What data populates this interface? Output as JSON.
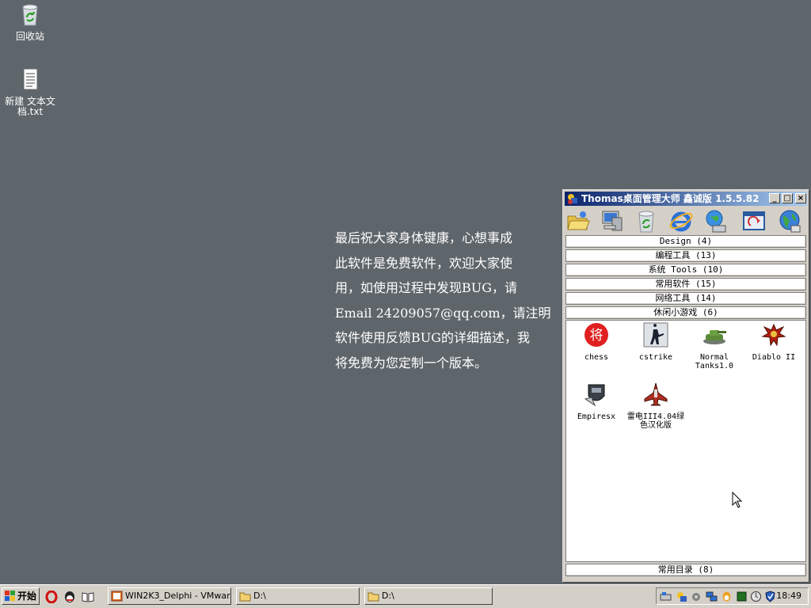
{
  "desktop": {
    "icons": [
      {
        "label": "回收站",
        "icon": "recycle-bin-icon"
      },
      {
        "label": "新建 文本文档.txt",
        "icon": "text-document-icon"
      }
    ],
    "message": "最后祝大家身体键康，心想事成\n此软件是免费软件，欢迎大家使\n用，如使用过程中发现BUG，请\nEmail 24209057@qq.com，请注明\n软件使用反馈BUG的详细描述，我\n将免费为您定制一个版本。"
  },
  "window": {
    "title": "Thomas桌面管理大师 鑫诚版 1.5.5.82",
    "toolbar": [
      "open-folder-icon",
      "my-computer-icon",
      "recycle-bin-icon",
      "internet-explorer-icon",
      "network-icon",
      "refresh-window-icon",
      "globe-icon"
    ],
    "categories": [
      {
        "label": "Design (4)"
      },
      {
        "label": "编程工具 (13)"
      },
      {
        "label": "系统  Tools (10)"
      },
      {
        "label": "常用软件 (15)"
      },
      {
        "label": "网络工具 (14)"
      },
      {
        "label": "休闲小游戏 (6)"
      }
    ],
    "items": [
      {
        "label": "chess",
        "icon": "chess-icon"
      },
      {
        "label": "cstrike",
        "icon": "cstrike-icon"
      },
      {
        "label": "Normal Tanks1.0",
        "icon": "tank-icon"
      },
      {
        "label": "Diablo II",
        "icon": "diablo-icon"
      },
      {
        "label": "Empiresx",
        "icon": "empires-icon"
      },
      {
        "label": "雷电III4.04绿色汉化版",
        "icon": "raiden-icon"
      }
    ],
    "bottom_category": "常用目录 (8)"
  },
  "taskbar": {
    "start_label": "开始",
    "tasks": [
      {
        "label": "WIN2K3_Delphi - VMwar...",
        "icon": "vmware-icon"
      },
      {
        "label": "D:\\",
        "icon": "folder-icon"
      },
      {
        "label": "D:\\",
        "icon": "folder-icon"
      }
    ],
    "clock": "18:49"
  },
  "colors": {
    "desktop_bg": "#5f666b",
    "title_start": "#0a246a",
    "title_end": "#a6caf0",
    "face": "#d4d0c8"
  }
}
